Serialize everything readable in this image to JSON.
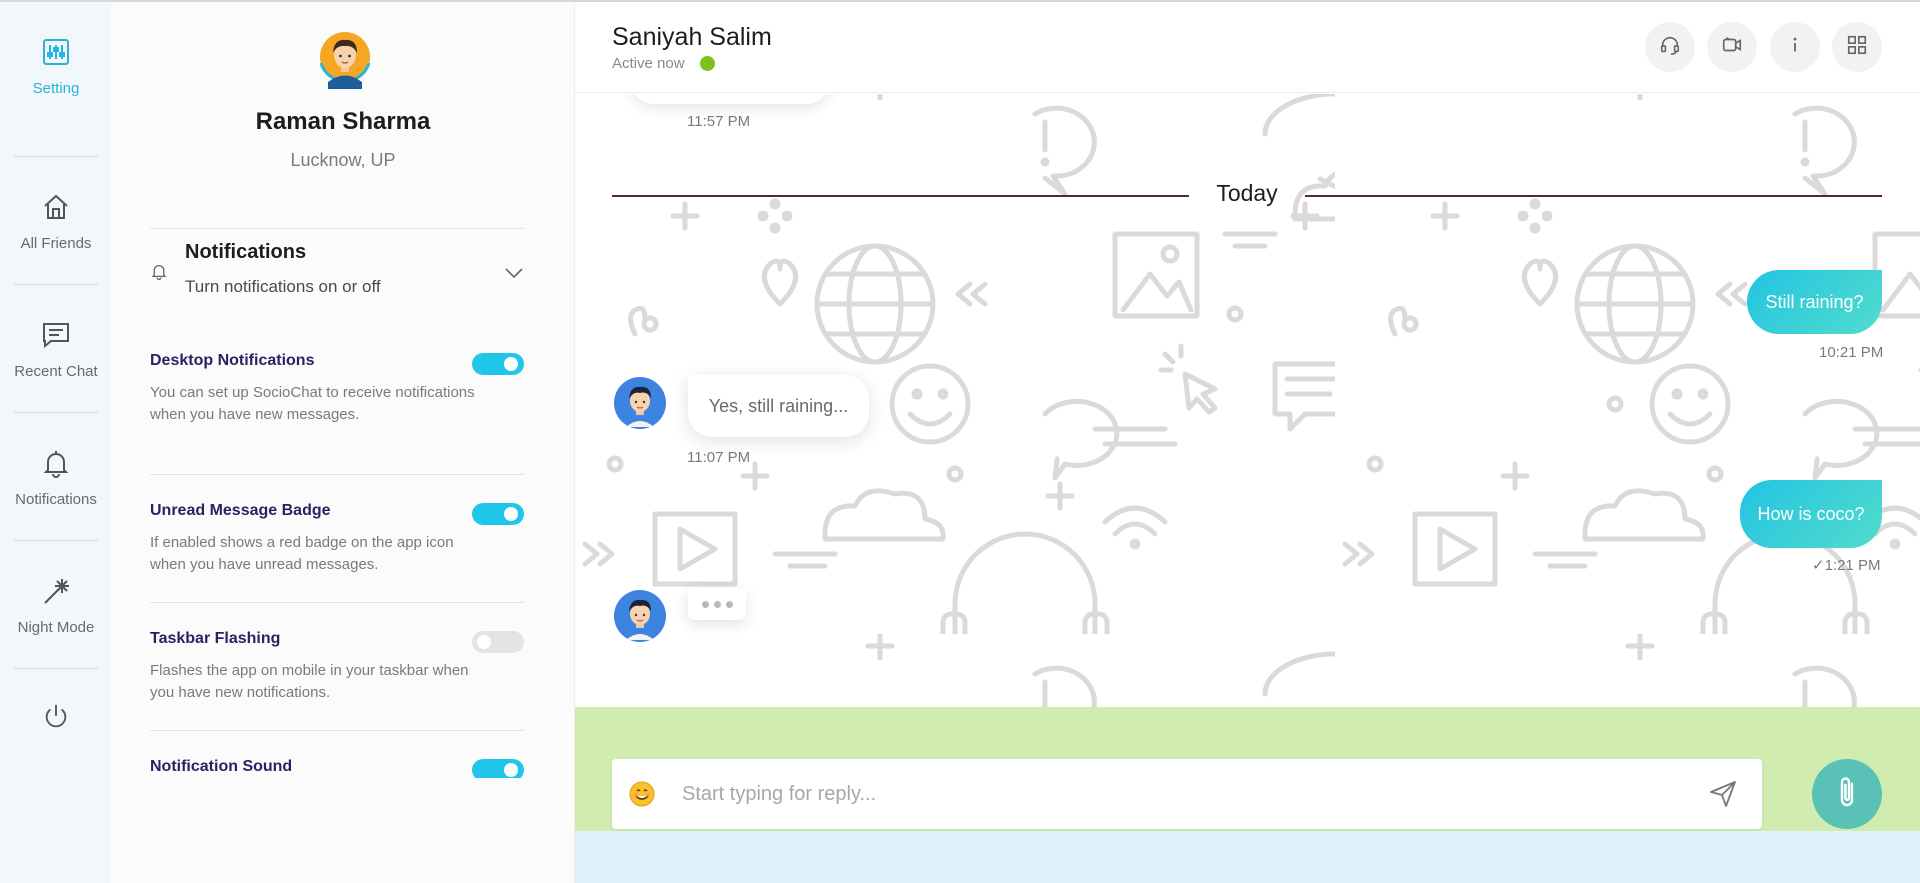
{
  "nav": {
    "items": [
      {
        "label": "Setting",
        "icon": "sliders-icon",
        "active": true
      },
      {
        "label": "All Friends",
        "icon": "home-icon"
      },
      {
        "label": "Recent Chat",
        "icon": "chat-icon"
      },
      {
        "label": "Notifications",
        "icon": "bell-icon"
      },
      {
        "label": "Night Mode",
        "icon": "magic-wand-icon"
      }
    ],
    "power_icon": "power-icon"
  },
  "profile": {
    "name": "Raman Sharma",
    "location": "Lucknow, UP"
  },
  "settings": {
    "notifications": {
      "title": "Notifications",
      "subtitle": "Turn notifications on or off"
    },
    "options": [
      {
        "title": "Desktop Notifications",
        "description": "You can set up SocioChat to receive notifications when you have new messages.",
        "enabled": true
      },
      {
        "title": "Unread Message Badge",
        "description": "If enabled shows a red badge on the app icon when you have unread messages.",
        "enabled": true
      },
      {
        "title": "Taskbar Flashing",
        "description": "Flashes the app on mobile in your taskbar when you have new notifications.",
        "enabled": false
      },
      {
        "title": "Notification Sound",
        "description": "",
        "enabled": true
      }
    ]
  },
  "chat": {
    "contact_name": "Saniyah Salim",
    "status": "Active now",
    "header_buttons": [
      "headset-icon",
      "video-camera-icon",
      "info-icon",
      "grid-icon"
    ],
    "earlier_time": "11:57 PM",
    "day_separator": "Today",
    "messages": [
      {
        "direction": "out",
        "text": "Still raining?",
        "time": "10:21 PM"
      },
      {
        "direction": "in",
        "text": "Yes, still raining...",
        "time": "11:07 PM"
      },
      {
        "direction": "out",
        "text": "How is coco?",
        "time": "1:21 PM",
        "status_mark": "✓"
      }
    ],
    "typing": true,
    "reply_placeholder": "Start typing for reply..."
  },
  "colors": {
    "accent": "#27b5db",
    "toggle_on": "#1fc6ea",
    "toggle_off": "#e4e4e4",
    "online": "#7cc21b",
    "bubble_out_start": "#22c4e2",
    "bubble_out_end": "#52dccc",
    "option_title": "#2d1f63",
    "day_line": "#5a2a26",
    "input_band": "#d0ecb0",
    "attach_button": "#5ac1b7"
  }
}
